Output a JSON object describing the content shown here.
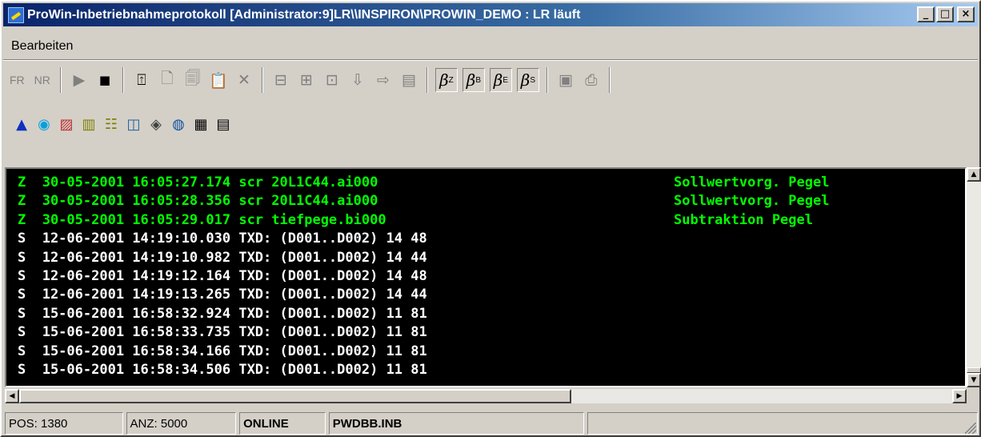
{
  "window": {
    "title": "ProWin-Inbetriebnahmeprotokoll [Administrator:9]LR\\\\INSPIRON\\PROWIN_DEMO : LR läuft",
    "minimize": "_",
    "maximize": "□",
    "close": "×"
  },
  "menu": {
    "edit": "Bearbeiten"
  },
  "toolbar": {
    "fr": "FR",
    "nr": "NR",
    "play": "▶",
    "stop": "■",
    "pen_z": "Z",
    "pen_b": "B",
    "pen_e": "E",
    "pen_s": "S"
  },
  "log": {
    "lines": [
      {
        "text": "Z  30-05-2001 16:05:27.174 scr 20L1C44.ai000",
        "comment": "Sollwertvorg. Pegel",
        "color": "#00ff00"
      },
      {
        "text": "Z  30-05-2001 16:05:28.356 scr 20L1C44.ai000",
        "comment": "Sollwertvorg. Pegel",
        "color": "#00ff00"
      },
      {
        "text": "Z  30-05-2001 16:05:29.017 scr tiefpege.bi000",
        "comment": "Subtraktion Pegel",
        "color": "#00ff00"
      },
      {
        "text": "S  12-06-2001 14:19:10.030 TXD: (D001..D002) 14 48",
        "comment": "",
        "color": "#ffffff"
      },
      {
        "text": "S  12-06-2001 14:19:10.982 TXD: (D001..D002) 14 44",
        "comment": "",
        "color": "#ffffff"
      },
      {
        "text": "S  12-06-2001 14:19:12.164 TXD: (D001..D002) 14 48",
        "comment": "",
        "color": "#ffffff"
      },
      {
        "text": "S  12-06-2001 14:19:13.265 TXD: (D001..D002) 14 44",
        "comment": "",
        "color": "#ffffff"
      },
      {
        "text": "S  15-06-2001 16:58:32.924 TXD: (D001..D002) 11 81",
        "comment": "",
        "color": "#ffffff"
      },
      {
        "text": "S  15-06-2001 16:58:33.735 TXD: (D001..D002) 11 81",
        "comment": "",
        "color": "#ffffff"
      },
      {
        "text": "S  15-06-2001 16:58:34.166 TXD: (D001..D002) 11 81",
        "comment": "",
        "color": "#ffffff"
      },
      {
        "text": "S  15-06-2001 16:58:34.506 TXD: (D001..D002) 11 81",
        "comment": "",
        "color": "#ffffff"
      }
    ]
  },
  "status": {
    "pos": "POS: 1380",
    "anz": "ANZ: 5000",
    "mode": "ONLINE",
    "file": "PWDBB.INB"
  }
}
